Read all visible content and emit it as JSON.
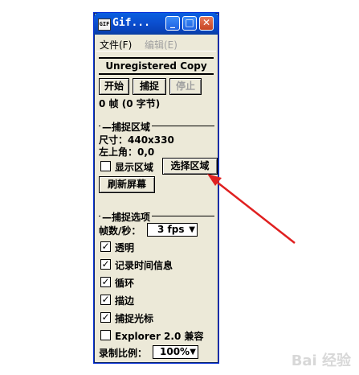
{
  "window": {
    "title": "Gif...",
    "app_icon_text": "GIF",
    "min_glyph": "_",
    "max_glyph": "□",
    "close_glyph": "✕"
  },
  "menu": {
    "file": "文件(F)",
    "edit": "编辑(E)"
  },
  "banner": "Unregistered Copy",
  "toolbar": {
    "start": "开始",
    "capture": "捕捉",
    "stop": "停止"
  },
  "status": "0 帧 (0 字节)",
  "capture_area": {
    "group_label": "捕捉区域",
    "size": "尺寸：440x330",
    "top_left": "左上角：0,0",
    "show_area_label": "显示区域",
    "select_area_button": "选择区域",
    "refresh_screen_button": "刷新屏幕"
  },
  "capture_options": {
    "group_label": "捕捉选项",
    "fps_label": "帧数/秒：",
    "fps_value": "3 fps",
    "options": [
      {
        "label": "透明",
        "checked": true
      },
      {
        "label": "记录时间信息",
        "checked": true
      },
      {
        "label": "循环",
        "checked": true
      },
      {
        "label": "描边",
        "checked": true
      },
      {
        "label": "捕捉光标",
        "checked": true
      },
      {
        "label": "Explorer 2.0 兼容",
        "checked": false
      }
    ],
    "scale_label": "录制比例：",
    "scale_value": "100%"
  },
  "annotation": {
    "arrow_color": "#e02020"
  },
  "watermark": "Bai 经验"
}
